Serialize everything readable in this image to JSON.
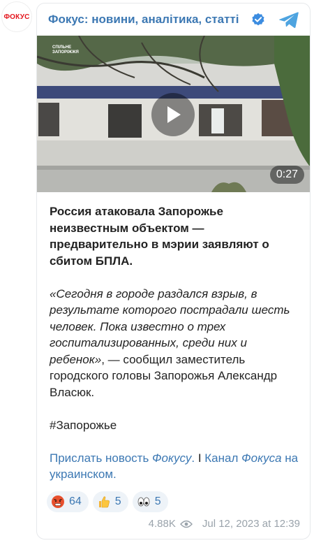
{
  "avatar": {
    "label": "ФОКУС"
  },
  "channel": {
    "name": "Фокус: новини, аналітика, статті"
  },
  "video": {
    "watermark": "СПІЛЬНЕ\nЗАПОРІЖЖЯ",
    "duration": "0:27"
  },
  "post": {
    "headline": "Россия атаковала Запорожье неизвестным объектом — предварительно в мэрии заявляют о сбитом БПЛА.",
    "quote_italic": "«Сегодня в городе раздался взрыв, в результате которого пострадали шесть человек. Пока известно о трех госпитализированных, среди них и ребенок»",
    "quote_tail": ", — сообщил заместитель городского головы Запорожья Александр Власюк.",
    "hashtag": "#Запорожье",
    "link1_part1": "Прислать новость ",
    "link1_part2": "Фокусу",
    "link1_part3": ".",
    "separator": " I ",
    "link2_part1": "Канал ",
    "link2_part2": "Фокуса",
    "link2_part3": " на украинском."
  },
  "reactions": [
    {
      "icon": "angry-face-emoji",
      "count": "64"
    },
    {
      "icon": "thumbs-up-emoji",
      "count": "5"
    },
    {
      "icon": "eyes-emoji",
      "count": "5"
    }
  ],
  "footer": {
    "views": "4.88K",
    "date": "Jul 12, 2023 at 12:39"
  },
  "colors": {
    "accent": "#3c78b3",
    "logo_red": "#e3141b",
    "reaction_bg": "#eef3f8",
    "meta": "#9aa3ab"
  }
}
